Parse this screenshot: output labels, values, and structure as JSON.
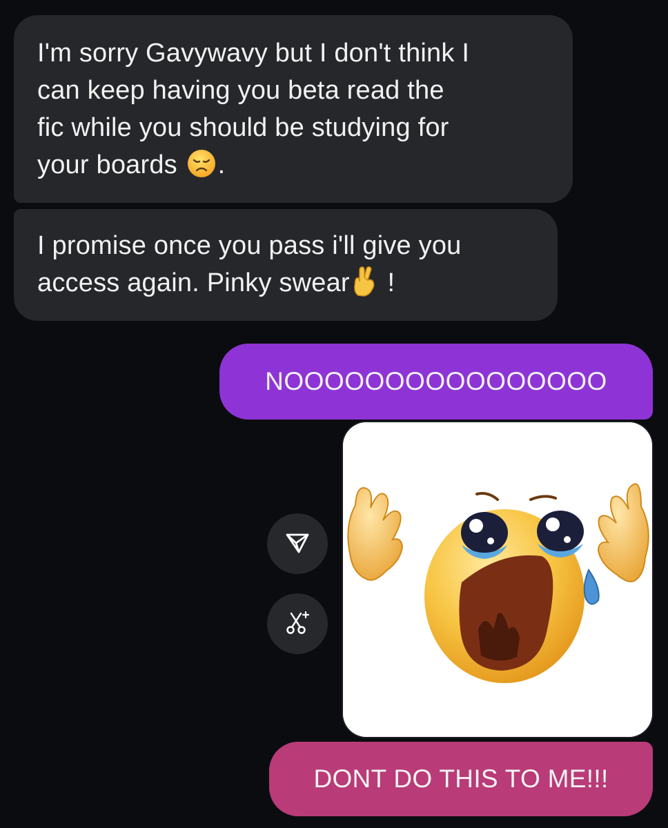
{
  "messages": [
    {
      "sender": "other",
      "lines": [
        "I'm sorry Gavywavy but I don't think I",
        "can keep having you beta read the",
        "fic while you should be studying for"
      ],
      "last_line_text": "your boards",
      "last_line_emoji": "disappointed-face-emoji",
      "last_line_suffix": "."
    },
    {
      "sender": "other",
      "lines": [
        "I promise once you pass i'll give you"
      ],
      "last_line_text": "access again. Pinky swear",
      "last_line_emoji": "crossed-fingers-emoji",
      "last_line_suffix": "!"
    },
    {
      "sender": "me",
      "text": "NOOOOOOOOOOOOOOOO",
      "color": "#8e34d6"
    },
    {
      "sender": "me",
      "type": "image",
      "image": "crying-emoji-sticker"
    },
    {
      "sender": "me",
      "text": "DONT DO THIS TO ME!!!",
      "color": "#b93b78"
    }
  ],
  "actions": {
    "share_icon": "paper-plane-icon",
    "remix_icon": "scissors-sparkle-icon"
  },
  "colors": {
    "background": "#0b0c10",
    "incoming_bubble": "#26272b",
    "text": "#f2f2f2"
  }
}
